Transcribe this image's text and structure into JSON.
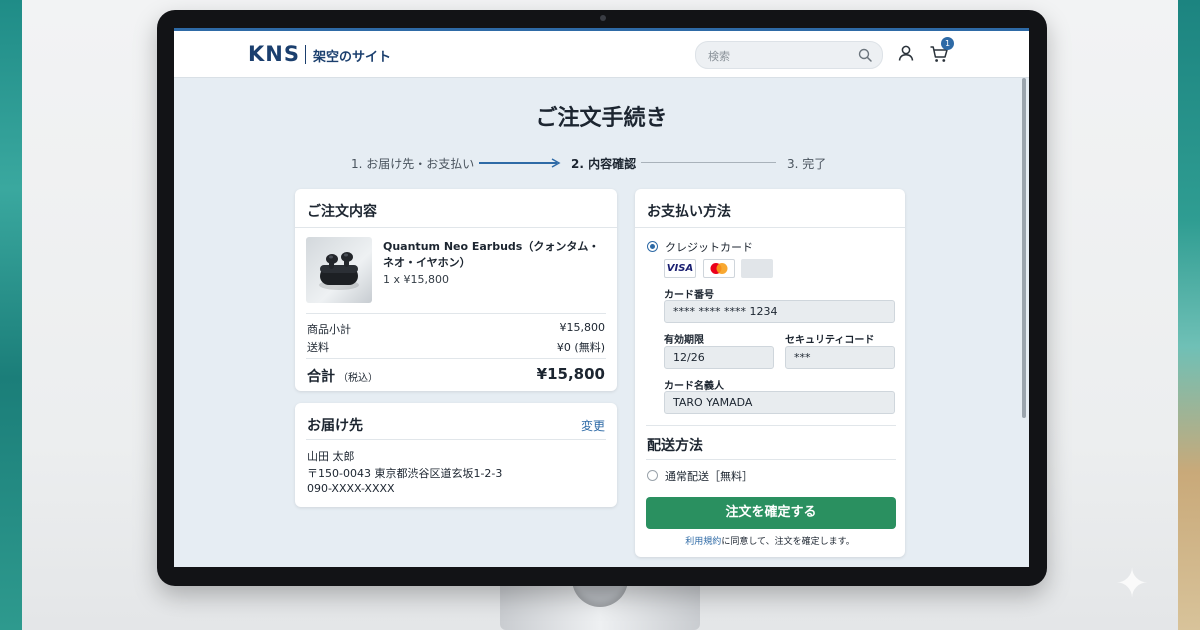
{
  "header": {
    "logo": "KNS",
    "site_name": "架空のサイト",
    "search_placeholder": "検索",
    "cart_count": "1"
  },
  "page": {
    "title": "ご注文手続き"
  },
  "steps": [
    {
      "label": "1. お届け先・お支払い",
      "state": "done"
    },
    {
      "label": "2. 内容確認",
      "state": "active"
    },
    {
      "label": "3. 完了",
      "state": "pending"
    }
  ],
  "order": {
    "title": "ご注文内容",
    "product_name": "Quantum Neo Earbuds（クォンタム・ネオ・イヤホン）",
    "product_qty": "1 x ¥15,800",
    "subtotal_label": "商品小計",
    "subtotal_value": "¥15,800",
    "shipping_label": "送料",
    "shipping_value": "¥0 (無料)",
    "total_label": "合計",
    "total_note": "（税込）",
    "total_value": "¥15,800"
  },
  "shipping_address": {
    "title": "お届け先",
    "change_label": "変更",
    "name": "山田 太郎",
    "address": "〒150-0043 東京都渋谷区道玄坂1-2-3",
    "phone": "090-XXXX-XXXX"
  },
  "payment": {
    "title": "お支払い方法",
    "method_label": "クレジットカード",
    "visa_label": "VISA",
    "card_number_label": "カード番号",
    "card_number_value": "**** **** **** 1234",
    "expiry_label": "有効期限",
    "expiry_value": "12/26",
    "cvc_label": "セキュリティコード",
    "cvc_value": "***",
    "holder_label": "カード名義人",
    "holder_value": "TARO YAMADA"
  },
  "delivery": {
    "title": "配送方法",
    "option_label": "通常配送［無料］"
  },
  "confirm_button": "注文を確定する",
  "terms": {
    "link": "利用規約",
    "text": "に同意して、注文を確定します。"
  },
  "colors": {
    "accent": "#2e6aa6",
    "confirm": "#2a9060",
    "brand": "#1b3f6e"
  }
}
